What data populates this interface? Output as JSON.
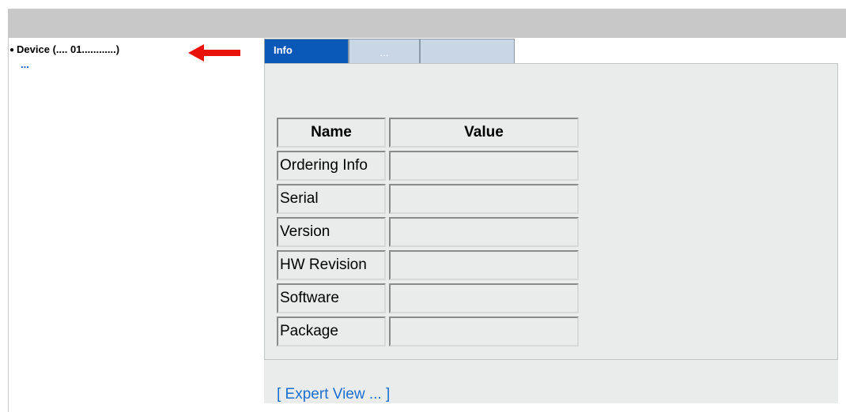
{
  "tree": {
    "device_label": "Device (.... 01............)",
    "sub_label": "..."
  },
  "tabs": [
    {
      "label": "Info",
      "active": true
    },
    {
      "label": "...",
      "active": false
    },
    {
      "label": "",
      "active": false
    }
  ],
  "table": {
    "headers": [
      "Name",
      "Value"
    ],
    "rows": [
      {
        "name": "Ordering Info",
        "value": ""
      },
      {
        "name": "Serial",
        "value": ""
      },
      {
        "name": "Version",
        "value": ""
      },
      {
        "name": "HW Revision",
        "value": ""
      },
      {
        "name": "Software",
        "value": ""
      },
      {
        "name": "Package",
        "value": ""
      }
    ]
  },
  "footer": {
    "expert_link": "[ Expert View ... ]"
  },
  "colors": {
    "accent": "#0a58b8",
    "arrow": "#e8140c",
    "link": "#1a6fcf"
  }
}
